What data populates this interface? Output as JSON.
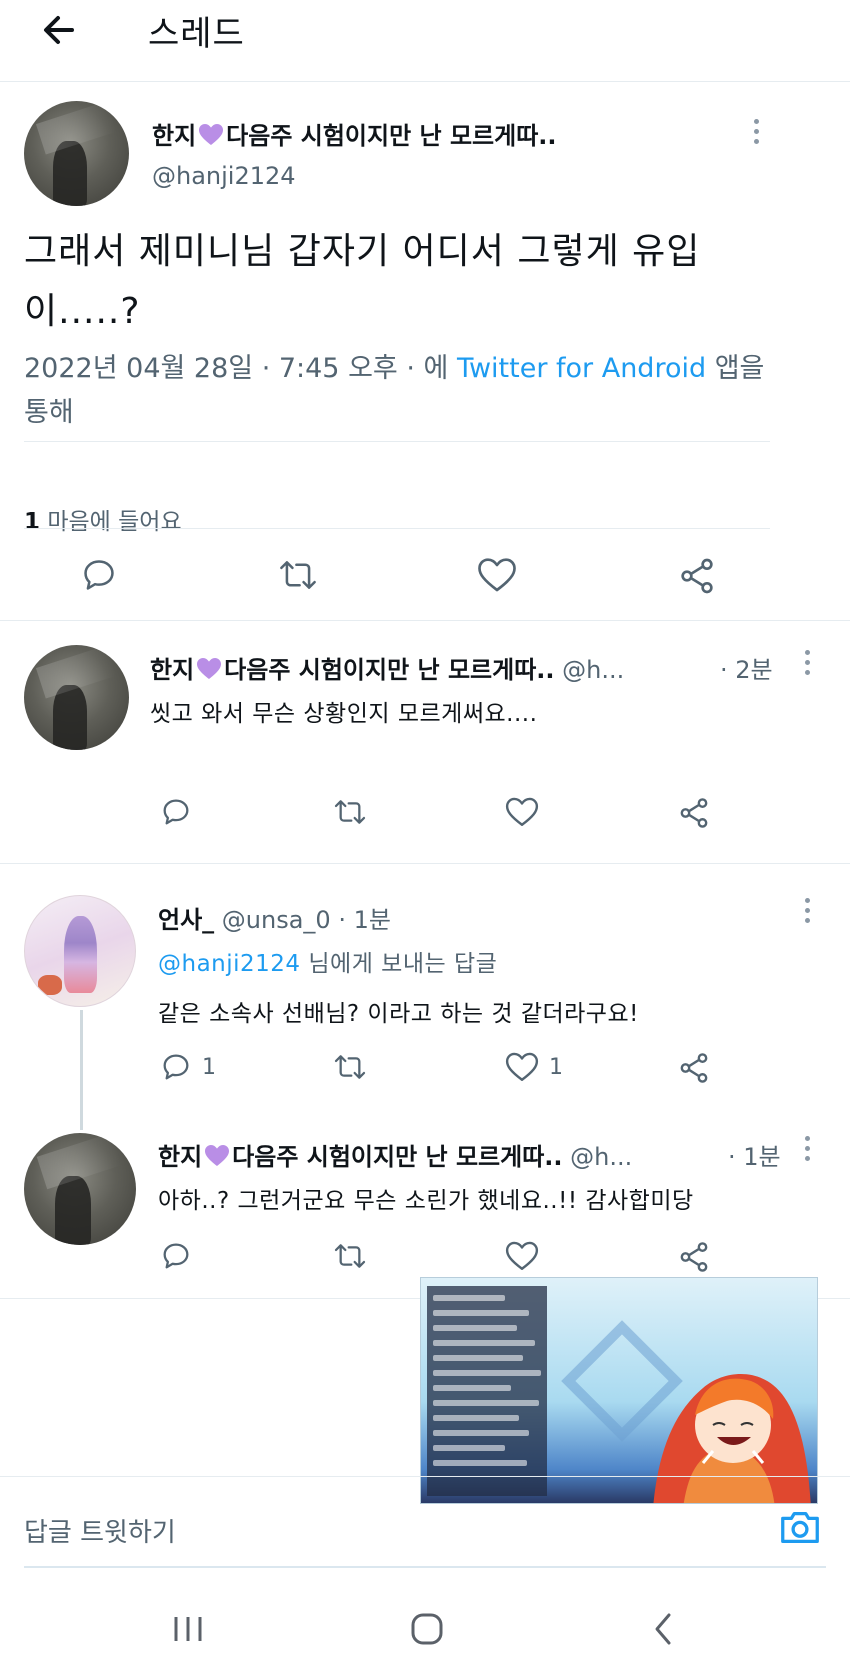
{
  "header": {
    "title": "스레드"
  },
  "main_tweet": {
    "display_name": "한지",
    "name_suffix": "다음주 시험이지만 난 모르게따..",
    "handle": "@hanji2124",
    "text": "그래서 제미니님 갑자기 어디서 그렇게 유입이.....?",
    "timestamp": "2022년 04월 28일 · 7:45 오후 · 에 ",
    "source": "Twitter for Android",
    "source_suffix": " 앱을 통해",
    "like_count": "1",
    "like_label": " 마음에 들어요"
  },
  "replies": [
    {
      "display_name": "한지",
      "name_suffix": "다음주 시험이지만 난 모르게따..",
      "handle_meta": " @h...",
      "time": "· 2분",
      "text": "씻고 와서 무슨 상황인지 모르게써요....",
      "reply_count": "",
      "like_count": ""
    },
    {
      "display_name": "언사_",
      "handle_meta": " @unsa_0 · 1분",
      "replying_to_handle": "@hanji2124",
      "replying_to_suffix": " 님에게 보내는 답글",
      "text": "같은 소속사 선배님? 이라고 하는 것 같더라구요!",
      "reply_count": "1",
      "like_count": "1"
    },
    {
      "display_name": "한지",
      "name_suffix": "다음주 시험이지만 난 모르게따..",
      "handle_meta": " @h...",
      "time": "· 1분",
      "text": "아하..? 그런거군요 무슨 소린가 했네요..!! 감사합미당",
      "reply_count": "",
      "like_count": ""
    }
  ],
  "composer": {
    "placeholder": "답글 트윗하기"
  },
  "colors": {
    "accent": "#1d9bf0",
    "secondary_text": "#536471",
    "heart_emoji": "#b98ee6"
  },
  "icons": {
    "back": "arrow-left-icon",
    "more": "more-vertical-icon",
    "reply": "reply-bubble-icon",
    "retweet": "retweet-icon",
    "like": "heart-outline-icon",
    "share": "share-icon",
    "camera": "camera-icon"
  }
}
